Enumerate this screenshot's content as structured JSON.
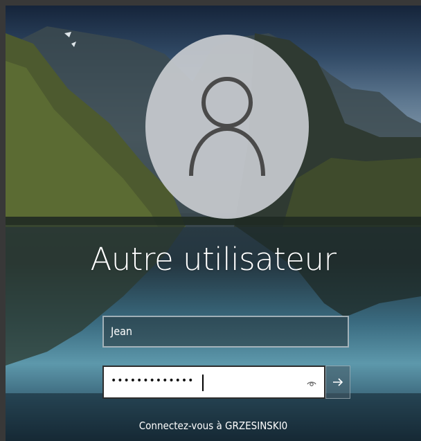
{
  "login": {
    "user_title": "Autre utilisateur",
    "username_value": "Jean",
    "password_masked": "•••••••••••••",
    "signin_text": "Connectez-vous à GRZESINSKI0"
  },
  "icons": {
    "avatar": "user-silhouette-icon",
    "reveal": "eye-icon",
    "submit": "arrow-right-icon"
  },
  "colors": {
    "text": "#ffffff",
    "avatar_bg": "#c8cbcf",
    "input_bg": "#ffffff"
  }
}
